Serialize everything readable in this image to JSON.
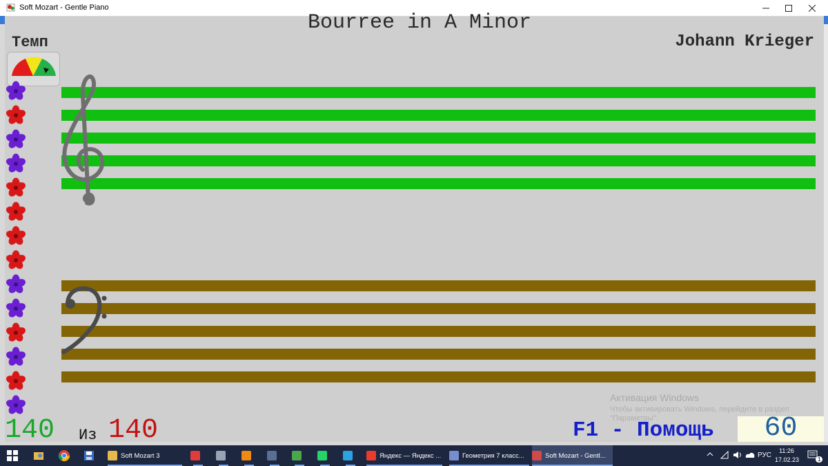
{
  "window": {
    "title": "Soft Mozart - Gentle Piano",
    "controls": [
      "minimize",
      "maximize",
      "close"
    ]
  },
  "score": {
    "piece_title": "Bourree in A Minor",
    "composer": "Johann Krieger",
    "treble_staff_color": "#10bf10",
    "bass_staff_color": "#836506"
  },
  "tempo": {
    "label": "Темп",
    "gauge_colors": [
      "#e21b1b",
      "#f2e61b",
      "#26b04a"
    ],
    "bpm": "60"
  },
  "progress": {
    "done": "140",
    "of_label": "Из",
    "total": "140",
    "done_color": "#19a82a",
    "total_color": "#c01313"
  },
  "help": {
    "label": "F1 - Помощь"
  },
  "flowers": [
    "purple",
    "red",
    "purple",
    "purple",
    "red",
    "red",
    "red",
    "red",
    "purple",
    "purple",
    "red",
    "purple",
    "red",
    "purple"
  ],
  "watermark": {
    "title": "Активация Windows",
    "subtitle": "Чтобы активировать Windows, перейдите в раздел \"Параметры\"."
  },
  "taskbar": {
    "pinned_icons": [
      "windows-start-icon",
      "file-explorer-icon",
      "chrome-icon",
      "save-floppy-icon"
    ],
    "tasks": [
      {
        "label": "Soft Mozart 3",
        "icon": "folder-icon"
      },
      {
        "label": "",
        "icon": "anydesk-icon"
      },
      {
        "label": "",
        "icon": "media-icon"
      },
      {
        "label": "",
        "icon": "vlc-icon"
      },
      {
        "label": "",
        "icon": "calculator-icon"
      },
      {
        "label": "",
        "icon": "puzzle-icon"
      },
      {
        "label": "",
        "icon": "whatsapp-icon"
      },
      {
        "label": "",
        "icon": "telegram-icon"
      },
      {
        "label": "Яндекс — Яндекс ...",
        "icon": "yandex-icon"
      },
      {
        "label": "Геометрия 7 класс...",
        "icon": "geometry-icon"
      },
      {
        "label": "Soft Mozart - Gentl...",
        "icon": "soft-mozart-icon"
      }
    ],
    "tray": {
      "language": "РУС",
      "time": "11:26",
      "date": "17.02.23",
      "notification_count": "1"
    }
  }
}
